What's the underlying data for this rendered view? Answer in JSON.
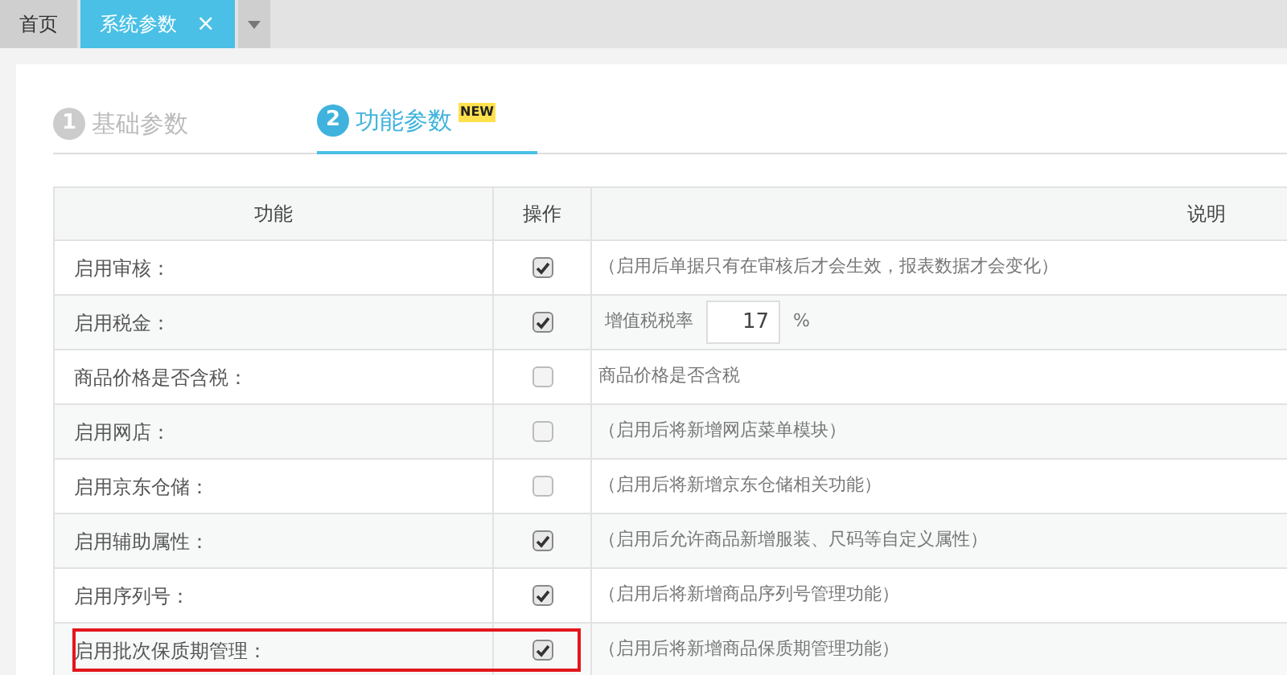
{
  "tabs": [
    {
      "label": "首页",
      "selected": false
    },
    {
      "label": "系统参数",
      "selected": true,
      "close": "×"
    }
  ],
  "steps": [
    {
      "number": "1",
      "label": "基础参数",
      "selected": false
    },
    {
      "number": "2",
      "label": "功能参数",
      "badge": "NEW",
      "selected": true
    }
  ],
  "table": {
    "columns": [
      "功能",
      "操作",
      "说明"
    ],
    "rows": [
      {
        "feature": "启用审核：",
        "checked": true,
        "highlighted": false,
        "kind": "text",
        "description": "（启用后单据只有在审核后才会生效，报表数据才会变化）"
      },
      {
        "feature": "启用税金：",
        "checked": true,
        "highlighted": false,
        "kind": "rate",
        "label": "增值税税率",
        "value": "17",
        "unit": "%"
      },
      {
        "feature": "商品价格是否含税：",
        "checked": false,
        "highlighted": false,
        "kind": "text",
        "description": "商品价格是否含税"
      },
      {
        "feature": "启用网店：",
        "checked": false,
        "highlighted": false,
        "kind": "text",
        "description": "（启用后将新增网店菜单模块）"
      },
      {
        "feature": "启用京东仓储：",
        "checked": false,
        "highlighted": false,
        "kind": "text",
        "description": "（启用后将新增京东仓储相关功能）"
      },
      {
        "feature": "启用辅助属性：",
        "checked": true,
        "highlighted": false,
        "kind": "text",
        "description": "（启用后允许商品新增服装、尺码等自定义属性）"
      },
      {
        "feature": "启用序列号：",
        "checked": true,
        "highlighted": false,
        "kind": "text",
        "description": "（启用后将新增商品序列号管理功能）"
      },
      {
        "feature": "启用批次保质期管理：",
        "checked": true,
        "highlighted": true,
        "kind": "text",
        "description": "（启用后将新增商品保质期管理功能）"
      }
    ]
  }
}
